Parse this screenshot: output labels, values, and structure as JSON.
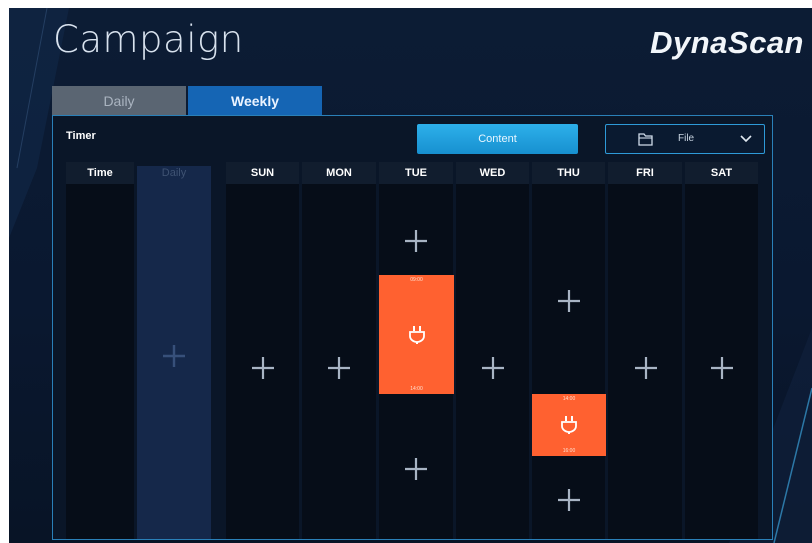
{
  "page": {
    "title": "Campaign",
    "brand": "DynaScan"
  },
  "tabs": [
    {
      "label": "Daily",
      "active": false
    },
    {
      "label": "Weekly",
      "active": true
    }
  ],
  "toolbar": {
    "timer_label": "Timer",
    "content_label": "Content",
    "file_label": "File"
  },
  "grid": {
    "time_header": "Time",
    "daily_header": "Daily",
    "days": [
      "SUN",
      "MON",
      "TUE",
      "WED",
      "THU",
      "FRI",
      "SAT"
    ]
  },
  "events": [
    {
      "day": "TUE",
      "start": "09:00",
      "end": "14:00",
      "icon": "plug-icon"
    },
    {
      "day": "THU",
      "start": "14:00",
      "end": "16:00",
      "icon": "plug-icon"
    }
  ],
  "colors": {
    "accent": "#1790d0",
    "tab_active": "#1565b4",
    "event": "#ff6130",
    "background": "#0c1c34"
  }
}
